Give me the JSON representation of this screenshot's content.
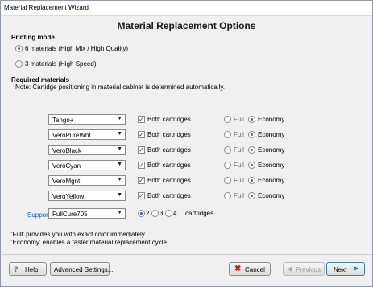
{
  "window": {
    "title": "Material Replacement Wizard"
  },
  "heading": "Material Replacement Options",
  "printing_mode": {
    "title": "Printing mode",
    "options": [
      {
        "label": "6 materials (High Mix / High Quality)",
        "selected": true
      },
      {
        "label": "3 materials (High Speed)",
        "selected": false
      }
    ]
  },
  "required": {
    "title": "Required materials",
    "note": "Note: Cartidge positioning in material cabinet is determined automatically."
  },
  "materials": [
    {
      "name": "Tango+",
      "both_label": "Both cartridges",
      "full": "Full",
      "economy": "Economy",
      "mode": "economy"
    },
    {
      "name": "VeroPureWht",
      "both_label": "Both cartridges",
      "full": "Full",
      "economy": "Economy",
      "mode": "economy"
    },
    {
      "name": "VeroBlack",
      "both_label": "Both cartridges",
      "full": "Full",
      "economy": "Economy",
      "mode": "economy"
    },
    {
      "name": "VeroCyan",
      "both_label": "Both cartridges",
      "full": "Full",
      "economy": "Economy",
      "mode": "economy"
    },
    {
      "name": "VeroMgnt",
      "both_label": "Both cartridges",
      "full": "Full",
      "economy": "Economy",
      "mode": "economy"
    },
    {
      "name": "VeroYellow",
      "both_label": "Both cartridges",
      "full": "Full",
      "economy": "Economy",
      "mode": "economy"
    }
  ],
  "support": {
    "label": "Support",
    "material": "FullCure705",
    "counts": [
      "2",
      "3",
      "4"
    ],
    "selected_count": "2",
    "suffix": "cartridges"
  },
  "footnotes": [
    "'Full' provides you with exact color immediately.",
    "'Economy' enables a faster material replacement cycle."
  ],
  "buttons": {
    "help": "Help",
    "advanced": "Advanced Settings...",
    "cancel": "Cancel",
    "previous": "Previous",
    "next": "Next"
  },
  "colors": {
    "accent": "#2b63c8",
    "support_label": "#1a56c8",
    "cancel_icon": "#c31c1c"
  }
}
